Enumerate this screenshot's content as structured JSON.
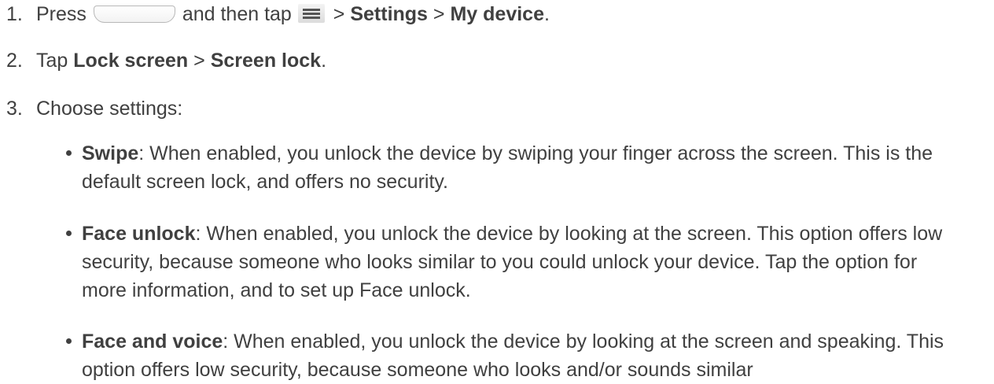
{
  "steps": [
    {
      "num": "1.",
      "press_text": "Press",
      "home_button_icon": "home-button-icon",
      "then_tap_text": "and then tap",
      "menu_icon": "menu-icon",
      "sep1": ">",
      "settings": "Settings",
      "sep2": ">",
      "my_device": "My device",
      "end": "."
    },
    {
      "num": "2.",
      "tap_text": "Tap",
      "lock_screen": "Lock screen",
      "sep": ">",
      "screen_lock": "Screen lock",
      "end": "."
    },
    {
      "num": "3.",
      "text": "Choose settings:"
    }
  ],
  "options": [
    {
      "title": "Swipe",
      "text": ": When enabled, you unlock the device by swiping your finger across the screen. This is the default screen lock, and offers no security."
    },
    {
      "title": "Face unlock",
      "text": ": When enabled, you unlock the device by looking at the screen. This option offers low security, because someone who looks similar to you could unlock your device. Tap the option for more information, and to set up Face unlock."
    },
    {
      "title": "Face and voice",
      "text": ": When enabled, you unlock the device by looking at the screen and speaking. This option offers low security, because someone who looks and/or sounds similar"
    }
  ]
}
